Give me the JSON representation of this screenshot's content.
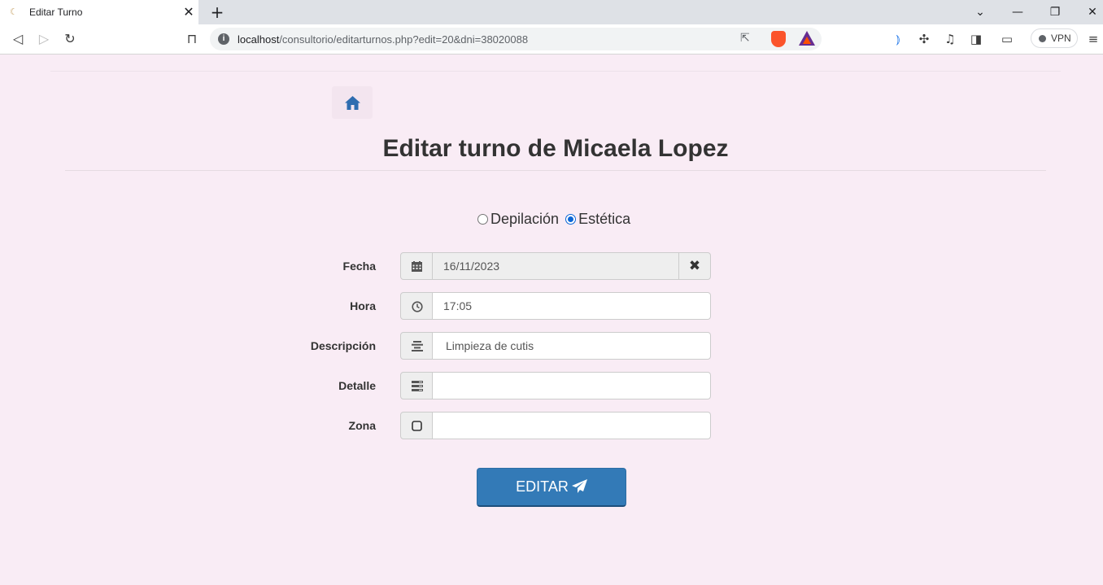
{
  "browser": {
    "tab_title": "Editar Turno",
    "tab_close": "✕",
    "new_tab": "+",
    "url_host": "localhost",
    "url_path": "/consultorio/editarturnos.php?edit=20&dni=38020088",
    "vpn_label": "VPN",
    "window_controls": [
      "⌄",
      "—",
      "❐",
      "✕"
    ]
  },
  "page": {
    "title": "Editar turno de Micaela Lopez"
  },
  "service_type": {
    "options": [
      "Depilación",
      "Estética"
    ],
    "selected": "Estética"
  },
  "form": {
    "fecha_label": "Fecha",
    "fecha_value": "16/11/2023",
    "fecha_clear": "✖",
    "hora_label": "Hora",
    "hora_value": "17:05",
    "descripcion_label": "Descripción",
    "descripcion_value": "Limpieza de cutis",
    "detalle_label": "Detalle",
    "detalle_value": "",
    "zona_label": "Zona",
    "zona_value": ""
  },
  "submit_label": "EDITAR",
  "colors": {
    "page_bg": "#f9ecf5",
    "primary": "#337ab7",
    "home_icon": "#2f6db0",
    "radio_checked": "#0b66d6"
  }
}
